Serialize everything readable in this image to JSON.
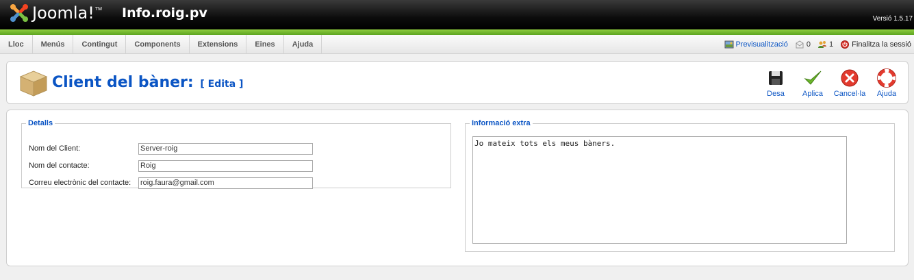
{
  "header": {
    "logo_text": "Joomla!",
    "site_name": "Info.roig.pv",
    "version": "Versió 1.5.17"
  },
  "menu": {
    "items": [
      {
        "label": "Lloc"
      },
      {
        "label": "Menús"
      },
      {
        "label": "Contingut"
      },
      {
        "label": "Components"
      },
      {
        "label": "Extensions"
      },
      {
        "label": "Eines"
      },
      {
        "label": "Ajuda"
      }
    ]
  },
  "status": {
    "preview": "Previsualització",
    "messages": "0",
    "users": "1",
    "logout": "Finalitza la sessió"
  },
  "toolbar": {
    "title": "Client del bàner:",
    "subtitle": "[ Edita ]",
    "buttons": [
      {
        "label": "Desa",
        "icon": "save-icon"
      },
      {
        "label": "Aplica",
        "icon": "apply-icon"
      },
      {
        "label": "Cancel·la",
        "icon": "cancel-icon"
      },
      {
        "label": "Ajuda",
        "icon": "help-icon"
      }
    ]
  },
  "details": {
    "legend": "Detalls",
    "fields": [
      {
        "label": "Nom del Client:",
        "value": "Server-roig"
      },
      {
        "label": "Nom del contacte:",
        "value": "Roig"
      },
      {
        "label": "Correu electrònic del contacte:",
        "value": "roig.faura@gmail.com"
      }
    ]
  },
  "extra": {
    "legend": "Informació extra",
    "text": "Jo mateix tots els meus bàners."
  },
  "colors": {
    "accent": "#0b55c4",
    "green": "#6cb52b"
  }
}
